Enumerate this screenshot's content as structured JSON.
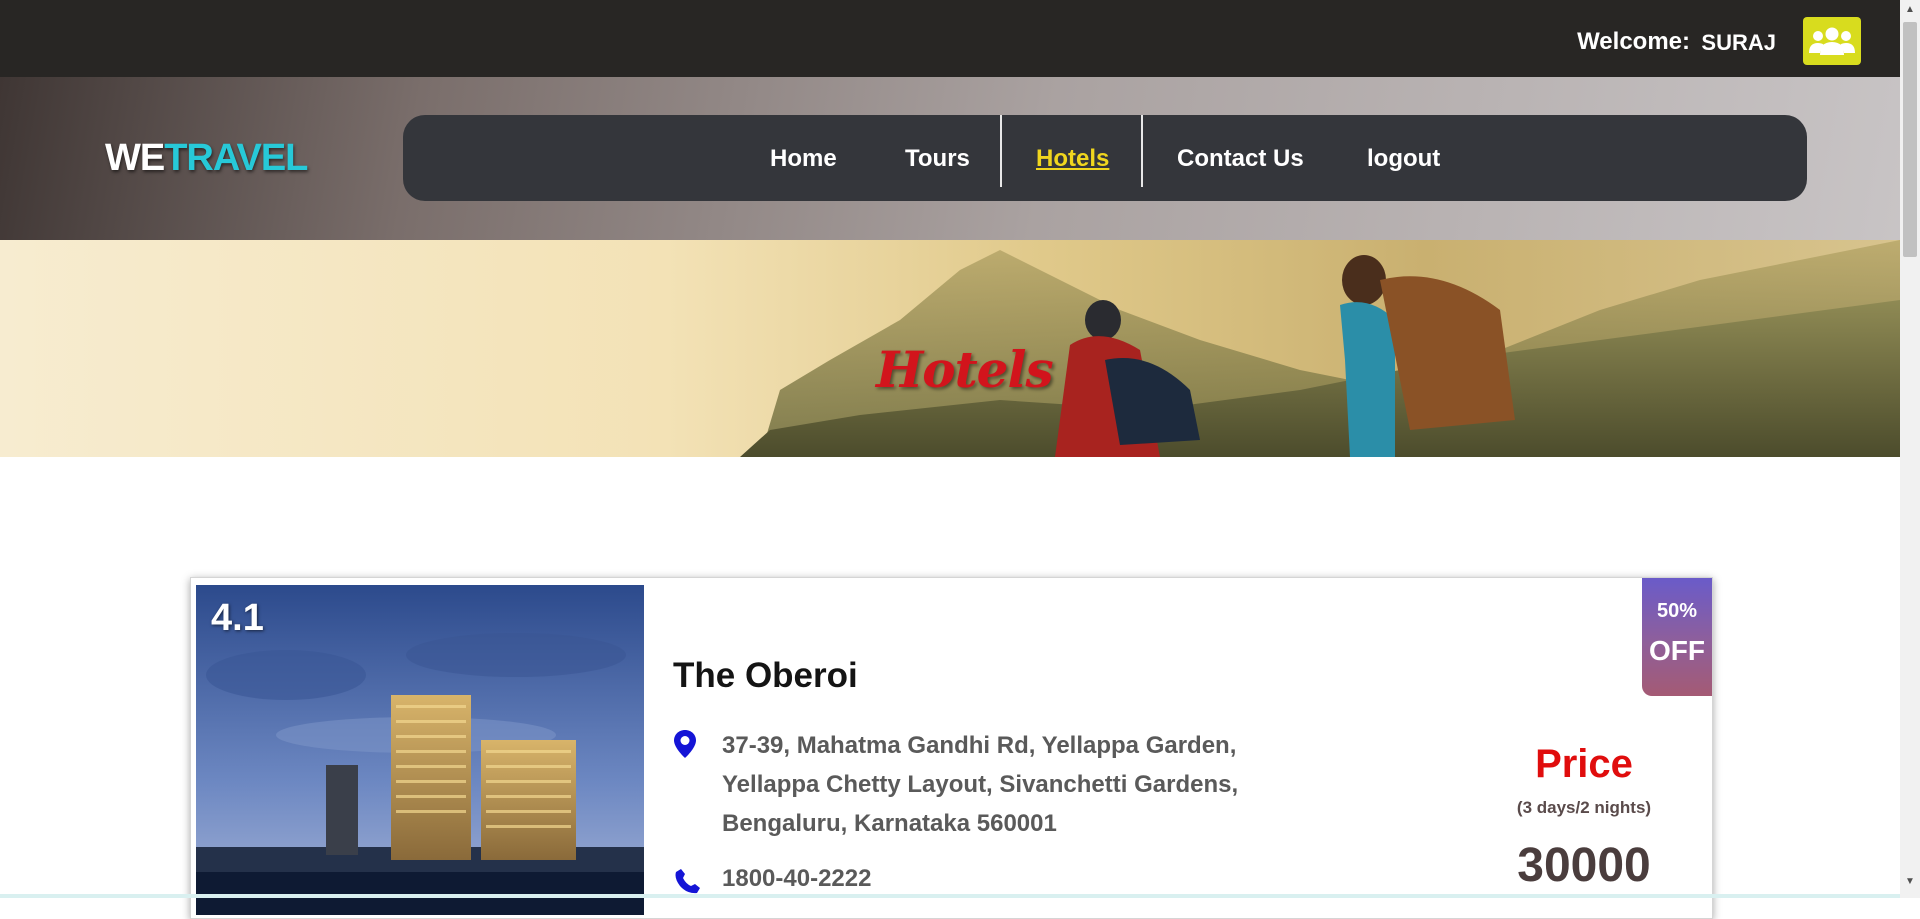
{
  "topbar": {
    "welcome_label": "Welcome:",
    "username": "SURAJ",
    "user_icon": "users-icon",
    "icon_color": "#d8dc1e"
  },
  "logo": {
    "part1": "WE",
    "part2": "TRAVEL",
    "part1_color": "#ffffff",
    "part2_color": "#27c9d8"
  },
  "nav": {
    "items": [
      {
        "label": "Home"
      },
      {
        "label": "Tours"
      },
      {
        "label": "Hotels",
        "active": true
      },
      {
        "label": "Contact Us"
      },
      {
        "label": "logout"
      }
    ],
    "active_color": "#f0d61e"
  },
  "banner": {
    "title": "Hotels",
    "title_color": "#d2141c"
  },
  "hotel": {
    "rating": "4.1",
    "name": "The Oberoi",
    "address_line1": "37-39, Mahatma Gandhi Rd, Yellappa Garden,",
    "address_line2": "Yellappa Chetty Layout, Sivanchetti Gardens,",
    "address_line3": "Bengaluru, Karnataka 560001",
    "phone": "1800-40-2222",
    "price_label": "Price",
    "duration": "(3 days/2 nights)",
    "price": "30000",
    "discount_percent": "50%",
    "discount_off": "OFF",
    "icon_color": "#1414d6"
  }
}
